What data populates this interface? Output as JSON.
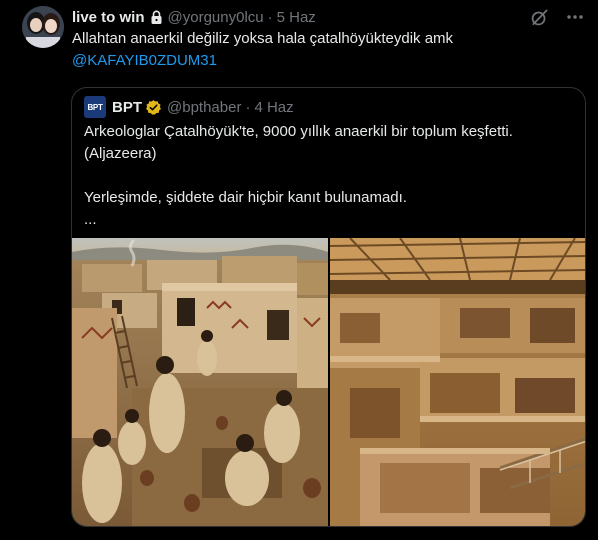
{
  "tweet": {
    "author_name": "live to win",
    "author_handle": "@yorguny0lcu",
    "separator": "·",
    "time": "5 Haz",
    "text": "Allahtan anaerkil değiliz yoksa hala çatalhöyükteydik amk",
    "mention": "@KAFAYIB0ZDUM31"
  },
  "quote": {
    "logo_text": "BPT",
    "author_name": "BPT",
    "author_handle": "@bpthaber",
    "separator": "·",
    "time": "4 Haz",
    "lines": [
      "Arkeologlar Çatalhöyük'te, 9000 yıllık anaerkil bir toplum keşfetti.",
      "(Aljazeera)",
      "",
      "Yerleşimde, şiddete dair hiçbir kanıt bulunamadı.",
      "..."
    ]
  },
  "icons": [
    "lock-icon",
    "grok-icon",
    "more-icon",
    "verified-badge-icon"
  ],
  "colors": {
    "background": "#000000",
    "text": "#e7e9ea",
    "secondary": "#71767b",
    "link": "#1d9bf0",
    "border": "#2f3336",
    "verified": "#e2b719"
  }
}
